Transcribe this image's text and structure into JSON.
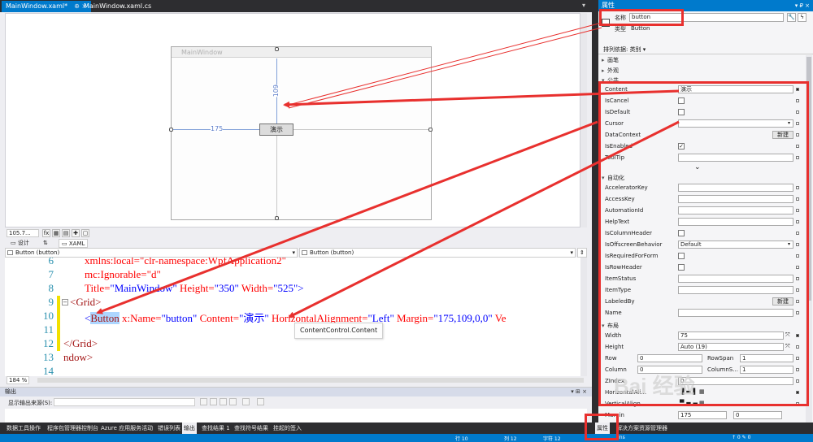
{
  "doc_tabs": [
    {
      "label": "MainWindow.xaml*",
      "pin": "⊕ ×",
      "active": true
    },
    {
      "label": "MainWindow.xaml.cs",
      "active": false
    }
  ],
  "designer": {
    "window_title": "MainWindow",
    "button_content": "演示",
    "margin_left_label": "175",
    "margin_top_label": "109",
    "zoom": "105.7...",
    "fx_label": "fx",
    "tabs": {
      "design": "设计",
      "swap": "⇅",
      "xaml": "XAML"
    }
  },
  "xaml_editor": {
    "left_combo": "Button (button)",
    "right_combo": "Button (button)",
    "zoom": "184 %",
    "tooltip": "ContentControl.Content",
    "line_numbers": [
      "6",
      "7",
      "8",
      "9",
      "10",
      "11",
      "12",
      "13",
      "14"
    ],
    "lines": {
      "l6": "xmlns:local=\"clr-namespace:WpfApplication2\"",
      "l7": "mc:Ignorable=\"d\"",
      "l8_attr": "Title=",
      "l8_val1": "\"MainWindow\"",
      "l8_attr2": " Height=",
      "l8_val2": "\"350\"",
      "l8_attr3": " Width=",
      "l8_val3": "\"525\"",
      "l8_end": ">",
      "l9": "<Grid>",
      "l10_open": "<",
      "l10_tag": "Button",
      "l10_a1": " x:Name=",
      "l10_v1": "\"button\"",
      "l10_a2": " Content=",
      "l10_v2": "\"演示\"",
      "l10_a3": " HorizontalAlignment=",
      "l10_v3": "\"Left\"",
      "l10_a4": " Margin=",
      "l10_v4": "\"175,109,0,0\"",
      "l10_a5": " Ve",
      "l12": "</Grid>",
      "l13": "ndow>"
    }
  },
  "output": {
    "title": "输出",
    "controls": "▾ ⊞ ×",
    "source_label": "显示输出来源(S):",
    "source_value": ""
  },
  "bottom_tabs": [
    "数据工具操作",
    "程序包管理器控制台",
    "Azure 应用服务活动",
    "错误列表",
    "输出",
    "查找结果 1",
    "查找符号结果",
    "挂起的签入"
  ],
  "bottom_right_tabs": [
    "属性",
    "解决方案资源管理器"
  ],
  "status": {
    "items": [
      "行 10",
      "列 12",
      "字符 12",
      "Ins"
    ],
    "right": "↑ 0   ✎ 0"
  },
  "properties": {
    "title": "属性",
    "controls": "▾ ₽ ×",
    "name_label": "名称",
    "name_value": "button",
    "type_label": "类型",
    "type_value": "Button",
    "arrange_label": "排列依据: 类别 ▾",
    "categories": {
      "brush": "画笔",
      "appearance": "外观",
      "common": "公共",
      "automation": "自动化",
      "layout": "布局"
    },
    "common_rows": {
      "content": {
        "name": "Content",
        "value": "演示"
      },
      "iscancel": {
        "name": "IsCancel"
      },
      "isdefault": {
        "name": "IsDefault"
      },
      "cursor": {
        "name": "Cursor"
      },
      "datacontext": {
        "name": "DataContext",
        "button": "新建"
      },
      "isenabled": {
        "name": "IsEnabled",
        "check": "✓"
      },
      "tooltip": {
        "name": "ToolTip"
      }
    },
    "automation_rows": [
      "AcceleratorKey",
      "AccessKey",
      "AutomationId",
      "HelpText",
      "IsColumnHeader",
      "IsOffscreenBehavior",
      "IsRequiredForForm",
      "IsRowHeader",
      "ItemStatus",
      "ItemType",
      "LabeledBy",
      "Name"
    ],
    "offscreen_value": "Default",
    "labeledby_button": "新建",
    "layout_rows": {
      "width": {
        "name": "Width",
        "value": "75"
      },
      "height": {
        "name": "Height",
        "value": "Auto (19)"
      },
      "row": {
        "name": "Row",
        "value": "0"
      },
      "rowspan": {
        "name": "RowSpan",
        "value": "1"
      },
      "column": {
        "name": "Column",
        "value": "0"
      },
      "columnspan": {
        "name": "ColumnS...",
        "value": "1"
      },
      "zindex": {
        "name": "ZIndex",
        "value": "0"
      },
      "halign": {
        "name": "HorizontalAli..."
      },
      "valign": {
        "name": "VerticalAlign..."
      },
      "margin": {
        "name": "Margin",
        "value1": "175",
        "value2": "0"
      }
    },
    "expand_glyph": "⌄"
  },
  "watermark": "Bai 经验",
  "accent_colors": {
    "vs_blue": "#007acc",
    "annotation_red": "#e8302e"
  }
}
